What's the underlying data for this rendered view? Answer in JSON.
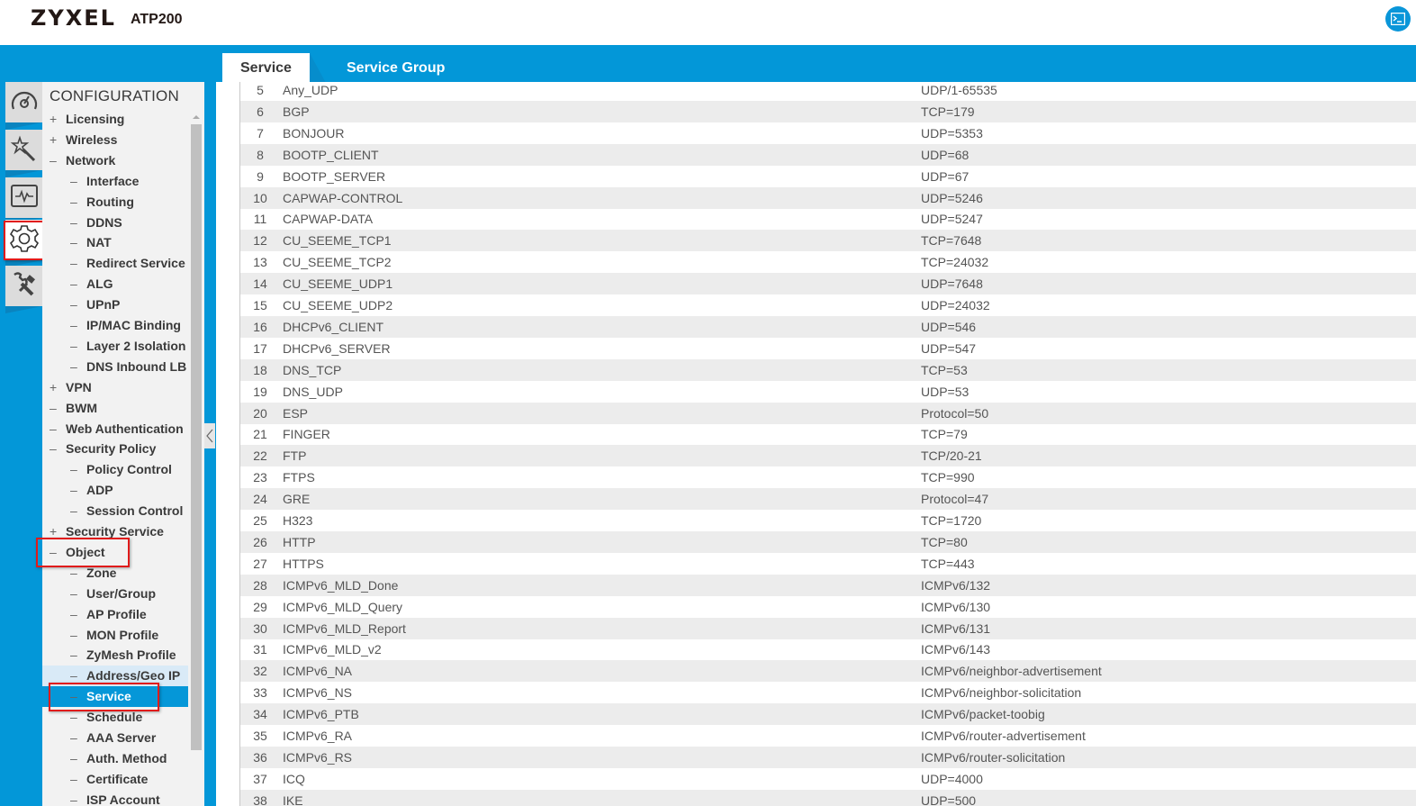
{
  "header": {
    "brand": "ZYXEL",
    "model": "ATP200",
    "console_icon": "console-icon"
  },
  "tabs": [
    {
      "label": "Service",
      "active": true
    },
    {
      "label": "Service Group",
      "active": false
    }
  ],
  "rail": [
    {
      "icon": "dashboard-icon"
    },
    {
      "icon": "wizard-icon"
    },
    {
      "icon": "monitor-icon"
    },
    {
      "icon": "configuration-gear-icon",
      "active": true
    },
    {
      "icon": "maintenance-tools-icon"
    }
  ],
  "nav": {
    "title": "CONFIGURATION",
    "items": [
      {
        "sym": "+",
        "label": "Licensing",
        "level": 1
      },
      {
        "sym": "+",
        "label": "Wireless",
        "level": 1
      },
      {
        "sym": "–",
        "label": "Network",
        "level": 1
      },
      {
        "sym": "–",
        "label": "Interface",
        "level": 2
      },
      {
        "sym": "–",
        "label": "Routing",
        "level": 2
      },
      {
        "sym": "–",
        "label": "DDNS",
        "level": 2
      },
      {
        "sym": "–",
        "label": "NAT",
        "level": 2
      },
      {
        "sym": "–",
        "label": "Redirect Service",
        "level": 2
      },
      {
        "sym": "–",
        "label": "ALG",
        "level": 2
      },
      {
        "sym": "–",
        "label": "UPnP",
        "level": 2
      },
      {
        "sym": "–",
        "label": "IP/MAC Binding",
        "level": 2
      },
      {
        "sym": "–",
        "label": "Layer 2 Isolation",
        "level": 2
      },
      {
        "sym": "–",
        "label": "DNS Inbound LB",
        "level": 2
      },
      {
        "sym": "+",
        "label": "VPN",
        "level": 1
      },
      {
        "sym": "–",
        "label": "BWM",
        "level": 1
      },
      {
        "sym": "–",
        "label": "Web Authentication",
        "level": 1
      },
      {
        "sym": "–",
        "label": "Security Policy",
        "level": 1
      },
      {
        "sym": "–",
        "label": "Policy Control",
        "level": 2
      },
      {
        "sym": "–",
        "label": "ADP",
        "level": 2
      },
      {
        "sym": "–",
        "label": "Session Control",
        "level": 2
      },
      {
        "sym": "+",
        "label": "Security Service",
        "level": 1
      },
      {
        "sym": "–",
        "label": "Object",
        "level": 1
      },
      {
        "sym": "–",
        "label": "Zone",
        "level": 2
      },
      {
        "sym": "–",
        "label": "User/Group",
        "level": 2
      },
      {
        "sym": "–",
        "label": "AP Profile",
        "level": 2
      },
      {
        "sym": "–",
        "label": "MON Profile",
        "level": 2
      },
      {
        "sym": "–",
        "label": "ZyMesh Profile",
        "level": 2
      },
      {
        "sym": "–",
        "label": "Address/Geo IP",
        "level": 2,
        "state": "hover"
      },
      {
        "sym": "–",
        "label": "Service",
        "level": 2,
        "state": "selected"
      },
      {
        "sym": "–",
        "label": "Schedule",
        "level": 2
      },
      {
        "sym": "–",
        "label": "AAA Server",
        "level": 2
      },
      {
        "sym": "–",
        "label": "Auth. Method",
        "level": 2
      },
      {
        "sym": "–",
        "label": "Certificate",
        "level": 2
      },
      {
        "sym": "–",
        "label": "ISP Account",
        "level": 2
      }
    ]
  },
  "table": {
    "rows": [
      {
        "num": "5",
        "name": "Any_UDP",
        "content": "UDP/1-65535"
      },
      {
        "num": "6",
        "name": "BGP",
        "content": "TCP=179"
      },
      {
        "num": "7",
        "name": "BONJOUR",
        "content": "UDP=5353"
      },
      {
        "num": "8",
        "name": "BOOTP_CLIENT",
        "content": "UDP=68"
      },
      {
        "num": "9",
        "name": "BOOTP_SERVER",
        "content": "UDP=67"
      },
      {
        "num": "10",
        "name": "CAPWAP-CONTROL",
        "content": "UDP=5246"
      },
      {
        "num": "11",
        "name": "CAPWAP-DATA",
        "content": "UDP=5247"
      },
      {
        "num": "12",
        "name": "CU_SEEME_TCP1",
        "content": "TCP=7648"
      },
      {
        "num": "13",
        "name": "CU_SEEME_TCP2",
        "content": "TCP=24032"
      },
      {
        "num": "14",
        "name": "CU_SEEME_UDP1",
        "content": "UDP=7648"
      },
      {
        "num": "15",
        "name": "CU_SEEME_UDP2",
        "content": "UDP=24032"
      },
      {
        "num": "16",
        "name": "DHCPv6_CLIENT",
        "content": "UDP=546"
      },
      {
        "num": "17",
        "name": "DHCPv6_SERVER",
        "content": "UDP=547"
      },
      {
        "num": "18",
        "name": "DNS_TCP",
        "content": "TCP=53"
      },
      {
        "num": "19",
        "name": "DNS_UDP",
        "content": "UDP=53"
      },
      {
        "num": "20",
        "name": "ESP",
        "content": "Protocol=50"
      },
      {
        "num": "21",
        "name": "FINGER",
        "content": "TCP=79"
      },
      {
        "num": "22",
        "name": "FTP",
        "content": "TCP/20-21"
      },
      {
        "num": "23",
        "name": "FTPS",
        "content": "TCP=990"
      },
      {
        "num": "24",
        "name": "GRE",
        "content": "Protocol=47"
      },
      {
        "num": "25",
        "name": "H323",
        "content": "TCP=1720"
      },
      {
        "num": "26",
        "name": "HTTP",
        "content": "TCP=80"
      },
      {
        "num": "27",
        "name": "HTTPS",
        "content": "TCP=443"
      },
      {
        "num": "28",
        "name": "ICMPv6_MLD_Done",
        "content": "ICMPv6/132"
      },
      {
        "num": "29",
        "name": "ICMPv6_MLD_Query",
        "content": "ICMPv6/130"
      },
      {
        "num": "30",
        "name": "ICMPv6_MLD_Report",
        "content": "ICMPv6/131"
      },
      {
        "num": "31",
        "name": "ICMPv6_MLD_v2",
        "content": "ICMPv6/143"
      },
      {
        "num": "32",
        "name": "ICMPv6_NA",
        "content": "ICMPv6/neighbor-advertisement"
      },
      {
        "num": "33",
        "name": "ICMPv6_NS",
        "content": "ICMPv6/neighbor-solicitation"
      },
      {
        "num": "34",
        "name": "ICMPv6_PTB",
        "content": "ICMPv6/packet-toobig"
      },
      {
        "num": "35",
        "name": "ICMPv6_RA",
        "content": "ICMPv6/router-advertisement"
      },
      {
        "num": "36",
        "name": "ICMPv6_RS",
        "content": "ICMPv6/router-solicitation"
      },
      {
        "num": "37",
        "name": "ICQ",
        "content": "UDP=4000"
      },
      {
        "num": "38",
        "name": "IKE",
        "content": "UDP=500"
      }
    ]
  },
  "colors": {
    "accent": "#0397d8",
    "highlight_box": "#e01b1b"
  }
}
